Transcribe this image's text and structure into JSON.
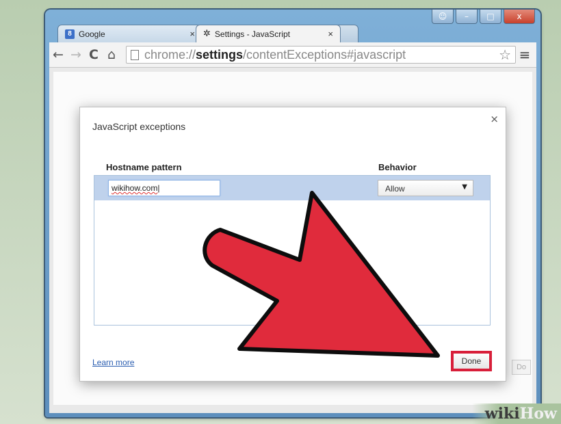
{
  "browser": {
    "tabs": [
      {
        "label": "Google",
        "icon": "google-favicon"
      },
      {
        "label": "Settings - JavaScript",
        "icon": "gear-icon"
      }
    ],
    "address": {
      "scheme": "chrome://",
      "host": "settings",
      "path": "/contentExceptions#javascript"
    },
    "window_controls": {
      "minimize": "–",
      "maximize": "□",
      "close": "x"
    }
  },
  "dialog": {
    "title": "JavaScript exceptions",
    "columns": {
      "hostname": "Hostname pattern",
      "behavior": "Behavior"
    },
    "row": {
      "hostname_value": "wikihow.com",
      "behavior_value": "Allow"
    },
    "learn_more": "Learn more",
    "done": "Done"
  },
  "background": {
    "done_label": "Do"
  },
  "watermark": {
    "part1": "wiki",
    "part2": "How"
  },
  "colors": {
    "highlight_red": "#d81f3a",
    "arrow_red": "#e02b3c",
    "row_selected": "#bfd2ec"
  }
}
